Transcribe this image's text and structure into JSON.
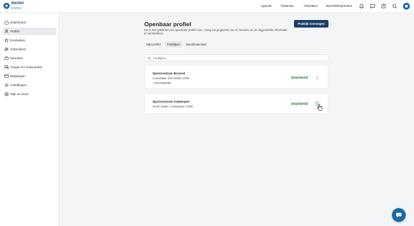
{
  "brand": {
    "name": "doctor",
    "sub": "anytime",
    "color": "#1b3f66",
    "accent": "#1b6aa5"
  },
  "topnav": {
    "items": [
      "Agenda",
      "Patiënten",
      "Afspraken",
      "Beschikbaarheden"
    ],
    "icons": [
      "bell-icon",
      "message-icon",
      "help-icon",
      "search-icon",
      "account-icon"
    ]
  },
  "sidebar": {
    "items": [
      {
        "label": "Dashboard",
        "icon": "home-icon",
        "active": false
      },
      {
        "label": "Profiel",
        "icon": "user-icon",
        "active": true
      },
      {
        "label": "Evaluaties",
        "icon": "star-icon",
        "active": false
      },
      {
        "label": "Gebruikers",
        "icon": "users-icon",
        "active": false
      },
      {
        "label": "Diensten",
        "icon": "briefcase-icon",
        "active": false
      },
      {
        "label": "Vragen en Antwoorden",
        "icon": "qa-icon",
        "active": false
      },
      {
        "label": "Betalingen",
        "icon": "card-icon",
        "active": false
      },
      {
        "label": "Instellingen",
        "icon": "gear-icon",
        "active": false
      },
      {
        "label": "Mijn account",
        "icon": "account-icon",
        "active": false
      }
    ]
  },
  "main": {
    "title": "Openbaar profiel",
    "description": "Dit is hoe patiënten uw openbaar profiel zien. Voeg uw gegevens toe en bewerk ze om bijgewerkte informatie te verstrekken.",
    "add_button": "Praktijk toevoegen",
    "tabs": [
      {
        "label": "Mijn profiel",
        "active": false
      },
      {
        "label": "Praktijken",
        "active": true
      },
      {
        "label": "Beeldmateriaal",
        "active": false
      }
    ],
    "search_placeholder": "Praktijken",
    "practices": [
      {
        "name": "Sportcentrum Brussel",
        "address": "Louizalaan 416 Ixelles 1050",
        "phone": "+3243499485",
        "status": "Geactiveerd"
      },
      {
        "name": "Sportcentrum Antwerpen",
        "address": "Grote markt 1 Antwerpen 2000",
        "status": "Geactiveerd"
      }
    ]
  }
}
